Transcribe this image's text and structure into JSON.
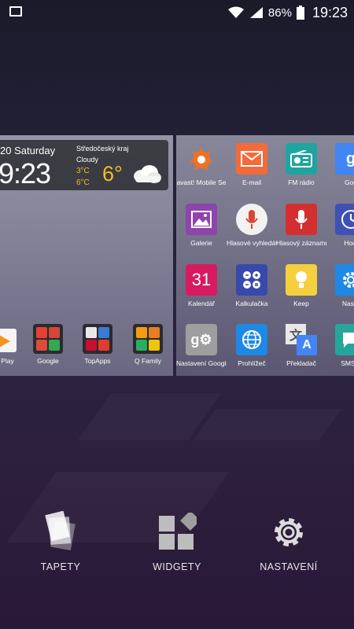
{
  "status_bar": {
    "battery": "86%",
    "time": "19:23"
  },
  "clock_widget": {
    "date": "20 Saturday",
    "time": "9:23",
    "region": "Středočeský kraj",
    "condition": "Cloudy",
    "temp_high": "3°C",
    "temp_low": "6°C",
    "temp_current": "6°"
  },
  "left_panel": {
    "items": [
      {
        "label": "d Play"
      },
      {
        "label": "Google"
      },
      {
        "label": "TopApps"
      },
      {
        "label": "Q Family"
      }
    ]
  },
  "apps": [
    {
      "label": "avast! Mobile Se",
      "icon": "avast-icon"
    },
    {
      "label": "E-mail",
      "icon": "email-icon"
    },
    {
      "label": "FM rádio",
      "icon": "radio-icon"
    },
    {
      "label": "Goo",
      "icon": "google-icon"
    },
    {
      "label": "Galerie",
      "icon": "gallery-icon"
    },
    {
      "label": "Hlasové vyhledáv",
      "icon": "voice-search-icon"
    },
    {
      "label": "Hlasový záznamn",
      "icon": "voice-recorder-icon"
    },
    {
      "label": "Hodi",
      "icon": "clock-icon"
    },
    {
      "label": "Kalendář",
      "icon": "calendar-icon",
      "day": "31"
    },
    {
      "label": "Kalkulačka",
      "icon": "calculator-icon"
    },
    {
      "label": "Keep",
      "icon": "keep-icon"
    },
    {
      "label": "Nasta",
      "icon": "settings-icon"
    },
    {
      "label": "Nastavení Google",
      "icon": "google-settings-icon"
    },
    {
      "label": "Prohlížeč",
      "icon": "browser-icon"
    },
    {
      "label": "Překladač",
      "icon": "translate-icon"
    },
    {
      "label": "SMS a",
      "icon": "sms-icon"
    }
  ],
  "options": {
    "wallpapers": "TAPETY",
    "widgets": "WIDGETY",
    "settings": "NASTAVENÍ"
  }
}
